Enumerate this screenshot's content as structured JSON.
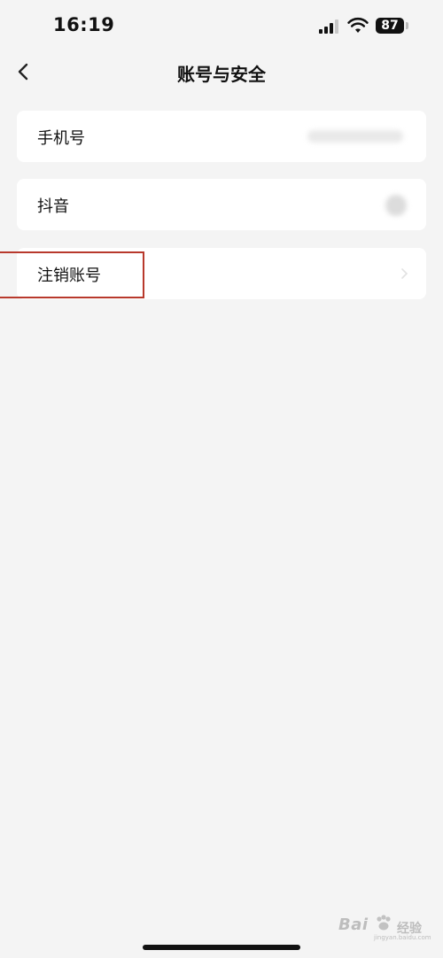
{
  "status_bar": {
    "time": "16:19",
    "battery": "87",
    "icons": [
      "signal-icon",
      "wifi-icon",
      "battery-icon"
    ]
  },
  "nav": {
    "back_icon": "chevron-left-icon",
    "title": "账号与安全"
  },
  "rows": [
    {
      "label": "手机号"
    },
    {
      "label": "抖音"
    },
    {
      "label": "注销账号"
    }
  ],
  "watermark": {
    "brand": "Bai",
    "sub": "经验",
    "url": "jingyan.baidu.com"
  },
  "colors": {
    "background": "#f4f4f4",
    "card": "#ffffff",
    "highlight": "#b8392c",
    "text": "#111111"
  }
}
